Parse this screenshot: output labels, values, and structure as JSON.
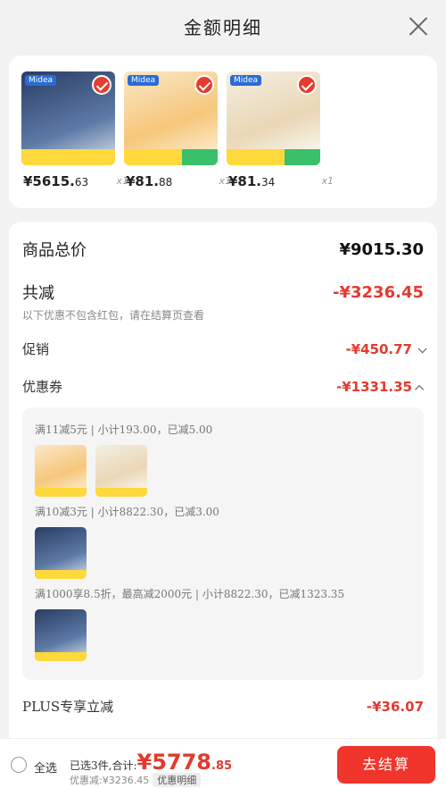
{
  "header": {
    "title": "金额明细"
  },
  "products": [
    {
      "price_main": "¥5615.",
      "price_cents": "63",
      "qty": "x1",
      "brand": "Midea"
    },
    {
      "price_main": "¥81.",
      "price_cents": "88",
      "qty": "x1",
      "brand": "Midea"
    },
    {
      "price_main": "¥81.",
      "price_cents": "34",
      "qty": "x1",
      "brand": "Midea"
    }
  ],
  "detail": {
    "total_label": "商品总价",
    "total_value": "¥9015.30",
    "discount_label": "共减",
    "discount_value": "-¥3236.45",
    "discount_note": "以下优惠不包含红包，请在结算页查看",
    "promo_label": "促销",
    "promo_value": "-¥450.77",
    "coupon_label": "优惠券",
    "coupon_value": "-¥1331.35",
    "coupons": [
      {
        "text": "满11减5元 | 小计193.00，已减5.00"
      },
      {
        "text": "满10减3元 | 小计8822.30，已减3.00"
      },
      {
        "text": "满1000享8.5折，最高减2000元 | 小计8822.30，已减1323.35"
      }
    ],
    "plus_label": "PLUS专享立减",
    "plus_value": "-¥36.07"
  },
  "bottom": {
    "select_all": "全选",
    "selected_text": "已选3件,合计:",
    "total_main": "¥5778",
    "total_cents": ".85",
    "discount_text": "优惠减:¥3236.45",
    "detail_button": "优惠明细",
    "checkout_button": "去结算"
  },
  "colors": {
    "accent_red": "#e23a2e",
    "checkout_bg": "#f0352c"
  }
}
